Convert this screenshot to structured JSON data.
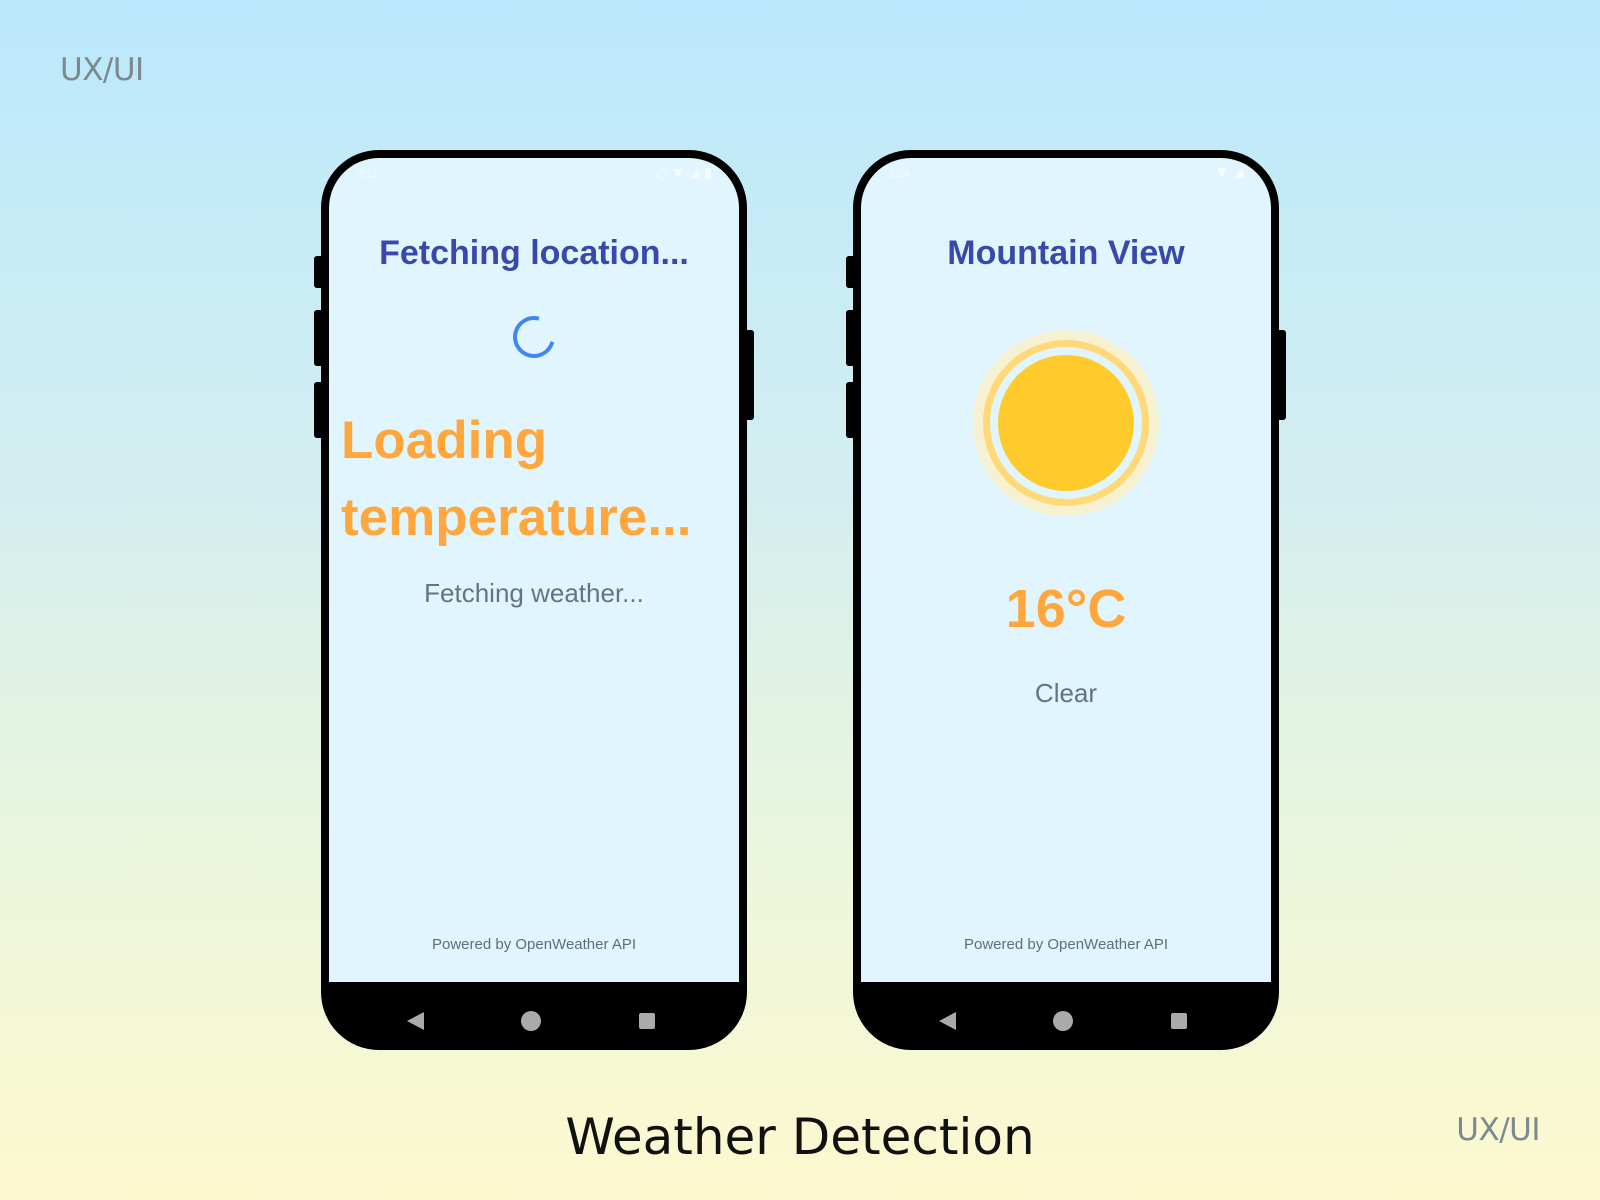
{
  "corner_labels": {
    "top_left": "UX/UI",
    "bottom_right": "UX/UI"
  },
  "page_title": "Weather Detection",
  "phones": [
    {
      "status_time": "2:11",
      "title": "Fetching location...",
      "temperature_text": "Loading temperature...",
      "subtitle": "Fetching weather...",
      "footer": "Powered by OpenWeather API",
      "status_icons": [
        "location-icon",
        "wifi-icon",
        "signal-icon",
        "battery-icon"
      ]
    },
    {
      "status_time": "2:26",
      "title": "Mountain View",
      "weather_icon": "sun-icon",
      "temperature": "16°C",
      "condition": "Clear",
      "footer": "Powered by OpenWeather API",
      "status_icons": [
        "wifi-icon",
        "signal-icon"
      ]
    }
  ],
  "nav_icons": [
    "back-icon",
    "home-icon",
    "recents-icon"
  ],
  "colors": {
    "title": "#3949ab",
    "temperature": "#ffa63d",
    "secondary_text": "#5f7782",
    "screen_bg": "#e1f5fe",
    "spinner": "#4285f4",
    "sun": "#ffca2c"
  }
}
